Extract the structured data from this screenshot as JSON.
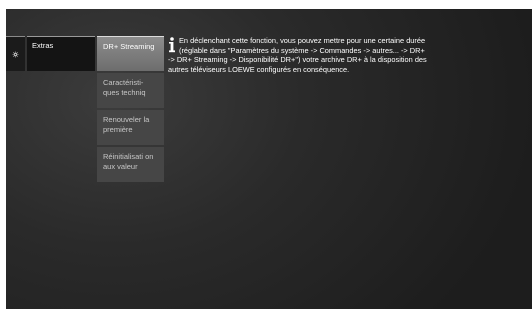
{
  "menu": {
    "settings_icon": "gear-icon",
    "extras_label": "Extras"
  },
  "submenu": {
    "items": [
      {
        "label": "DR+ Streaming",
        "selected": true
      },
      {
        "label": "Caractéristi-ques techniq",
        "selected": false
      },
      {
        "label": "Renouveler la première",
        "selected": false
      },
      {
        "label": "Réinitialisati on aux valeur",
        "selected": false
      }
    ]
  },
  "info": {
    "icon": "info-icon",
    "text": "En déclenchant cette fonction, vous pouvez mettre pour une certaine durée (réglable dans \"Paramètres du système -> Commandes -> autres... -> DR+ -> DR+ Streaming -> Disponibilité DR+\") votre archive DR+ à la disposition des autres téléviseurs LOEWE configurés en conséquence."
  },
  "colors": {
    "background": "#262626",
    "tile_dark": "#141414",
    "tile_selected": "#7d7d7d",
    "tile_normal": "#464646"
  }
}
